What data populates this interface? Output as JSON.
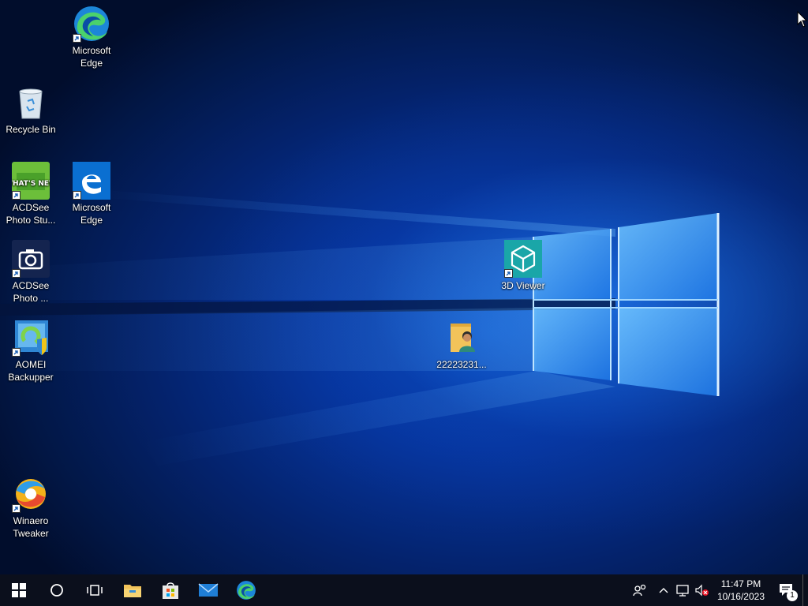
{
  "desktop": {
    "icons": [
      {
        "id": "edge-top",
        "label_line1": "Microsoft",
        "label_line2": "Edge"
      },
      {
        "id": "recycle-bin",
        "label_line1": "Recycle Bin",
        "label_line2": ""
      },
      {
        "id": "acdsee-studio",
        "label_line1": "ACDSee",
        "label_line2": "Photo Stu..."
      },
      {
        "id": "edge-legacy",
        "label_line1": "Microsoft",
        "label_line2": "Edge"
      },
      {
        "id": "acdsee-photo",
        "label_line1": "ACDSee",
        "label_line2": "Photo ..."
      },
      {
        "id": "aomei",
        "label_line1": "AOMEI",
        "label_line2": "Backupper"
      },
      {
        "id": "winaero",
        "label_line1": "Winaero",
        "label_line2": "Tweaker"
      },
      {
        "id": "3d-viewer",
        "label_line1": "3D Viewer",
        "label_line2": ""
      },
      {
        "id": "user-folder",
        "label_line1": "22223231...",
        "label_line2": ""
      }
    ],
    "acdsee_badge_text": "WHAT'S NEW"
  },
  "taskbar": {
    "pinned": [
      "start",
      "search",
      "task-view",
      "file-explorer",
      "microsoft-store",
      "mail",
      "edge"
    ],
    "clock_time": "11:47 PM",
    "clock_date": "10/16/2023",
    "notification_count": "1"
  },
  "colors": {
    "taskbar_bg": "#0b0f1c",
    "accent_blue": "#1a73e8"
  }
}
